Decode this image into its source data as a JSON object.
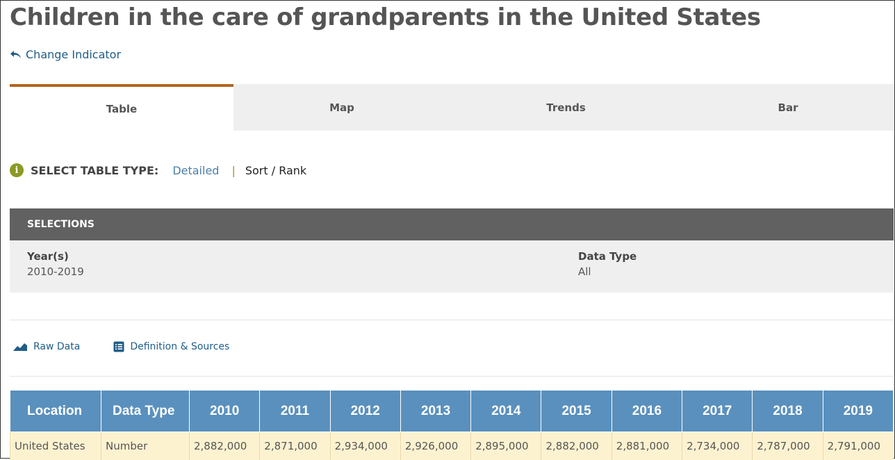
{
  "page": {
    "title": "Children in the care of grandparents in the United States",
    "change_indicator": "Change Indicator"
  },
  "tabs": [
    {
      "label": "Table",
      "active": true
    },
    {
      "label": "Map",
      "active": false
    },
    {
      "label": "Trends",
      "active": false
    },
    {
      "label": "Bar",
      "active": false
    }
  ],
  "table_type": {
    "label": "SELECT TABLE TYPE:",
    "detailed": "Detailed",
    "separator": "|",
    "sort_rank": "Sort / Rank"
  },
  "selections": {
    "heading": "SELECTIONS",
    "years_label": "Year(s)",
    "years_value": "2010-2019",
    "data_type_label": "Data Type",
    "data_type_value": "All"
  },
  "links": {
    "raw_data": "Raw Data",
    "definition_sources": "Definition & Sources"
  },
  "table": {
    "headers": [
      "Location",
      "Data Type",
      "2010",
      "2011",
      "2012",
      "2013",
      "2014",
      "2015",
      "2016",
      "2017",
      "2018",
      "2019"
    ],
    "rows": [
      [
        "United States",
        "Number",
        "2,882,000",
        "2,871,000",
        "2,934,000",
        "2,926,000",
        "2,895,000",
        "2,882,000",
        "2,881,000",
        "2,734,000",
        "2,787,000",
        "2,791,000"
      ]
    ]
  },
  "colors": {
    "accent_tab": "#b5651d",
    "header_blue": "#5a90bd",
    "row_cream": "#fdf2d0",
    "link_blue": "#1f5d87"
  }
}
